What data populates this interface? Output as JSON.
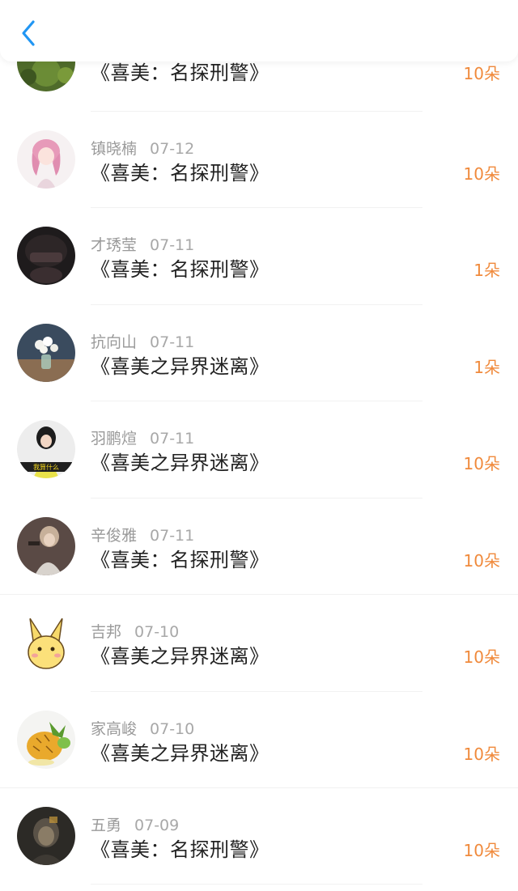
{
  "header": {
    "back_icon": "chevron-left-icon",
    "accent": "#2196f3"
  },
  "colors": {
    "amount": "#f08a3c",
    "name": "#9a9a9a",
    "title": "#222222"
  },
  "items": [
    {
      "name": "",
      "date": "",
      "title": "《喜美：名探刑警》",
      "amount": "10朵"
    },
    {
      "name": "镇晓楠",
      "date": "07-12",
      "title": "《喜美：名探刑警》",
      "amount": "10朵"
    },
    {
      "name": "才琇莹",
      "date": "07-11",
      "title": "《喜美：名探刑警》",
      "amount": "1朵"
    },
    {
      "name": "抗向山",
      "date": "07-11",
      "title": "《喜美之异界迷离》",
      "amount": "1朵"
    },
    {
      "name": "羽鹏煊",
      "date": "07-11",
      "title": "《喜美之异界迷离》",
      "amount": "10朵",
      "avatar_caption": "我算什么"
    },
    {
      "name": "辛俊雅",
      "date": "07-11",
      "title": "《喜美：名探刑警》",
      "amount": "10朵"
    },
    {
      "name": "吉邦",
      "date": "07-10",
      "title": "《喜美之异界迷离》",
      "amount": "10朵"
    },
    {
      "name": "家高峻",
      "date": "07-10",
      "title": "《喜美之异界迷离》",
      "amount": "10朵"
    },
    {
      "name": "五勇",
      "date": "07-09",
      "title": "《喜美：名探刑警》",
      "amount": "10朵"
    }
  ]
}
